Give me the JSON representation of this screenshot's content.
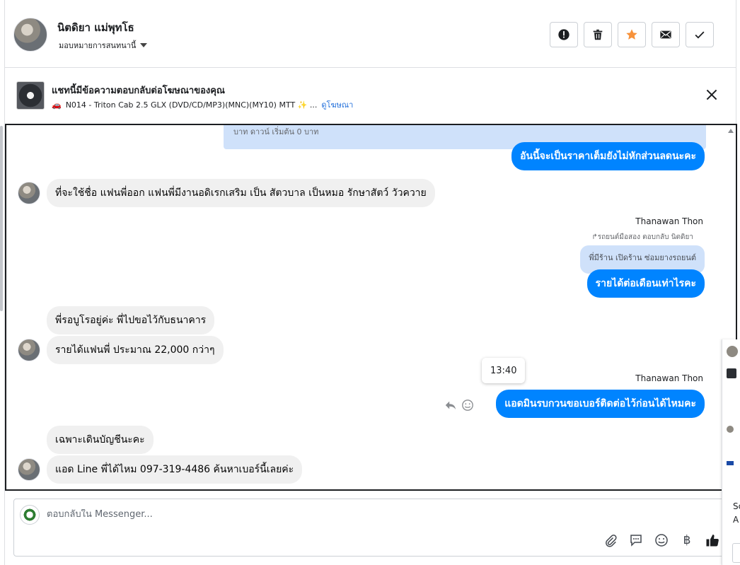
{
  "header": {
    "contact_name": "นิตดิยา แม่พุทโธ",
    "assign_label": "มอบหมายการสนทนานี้",
    "actions": [
      {
        "name": "report",
        "icon": "alert-icon"
      },
      {
        "name": "delete",
        "icon": "trash-icon"
      },
      {
        "name": "star",
        "icon": "star-icon",
        "color": "#f7923b"
      },
      {
        "name": "mark-unread",
        "icon": "envelope-icon"
      },
      {
        "name": "mark-done",
        "icon": "check-icon"
      }
    ]
  },
  "ad_banner": {
    "title": "แชทนี้มีข้อความตอบกลับต่อโฆษณาของคุณ",
    "subtitle": "N014 - Triton Cab 2.5 GLX (DVD/CD/MP3)(MNC)(MY10) MTT ✨ ...",
    "link_label": "ดูโฆษณา"
  },
  "messages": {
    "quoted_top": "บาท ดาวน์ เริ่มต้น 0 บาท",
    "m1": "อันนี้จะเป็นราคาเต็มยังไม่หักส่วนลดนะคะ",
    "m2": "ที่จะใช้ชื่อ แฟนพี่ออก แฟนพี่มีงานอดิเรกเสริม เป็น สัตวบาล เป็นหมอ รักษาสัตว์ วัวควาย",
    "sender_1": "Thanawan Thon",
    "reply_meta": "รถยนต์มือสอง ตอบกลับ นิตดิยา",
    "quote_text": "พี่มีร้าน เปิดร้าน ซ่อมยางรถยนต์",
    "m3": "รายได้ต่อเดือนเท่าไรคะ",
    "m4": "พี่รอบูโรอยู่ค่ะ พี่ไปขอไว้กับธนาคาร",
    "m5": "รายได้แฟนพี่ ประมาณ 22,000 กว่าๆ",
    "time_tooltip": "13:40",
    "sender_2": "Thanawan Thon",
    "m6": "แอดมินรบกวนขอเบอร์ติดต่อไว้ก่อนได้ไหมคะ",
    "m7": "เฉพาะเดินบัญชีนะคะ",
    "m8": "แอด Line พี่ได้ไหม 097-319-4486 ค้นหาเบอร์นี้เลยค่ะ"
  },
  "composer": {
    "placeholder": "ตอบกลับใน Messenger...",
    "tools": [
      "paperclip-icon",
      "saved-reply-icon",
      "emoji-icon",
      "baht-icon",
      "thumbs-up-icon"
    ],
    "baht_symbol": "฿"
  },
  "side_panel": {
    "text_1": "Sc",
    "text_2": "A"
  },
  "colors": {
    "outgoing_bubble": "#0084ff",
    "incoming_bubble": "#f0f0f0",
    "quote_bg": "#cfe1fa",
    "link": "#216fdb"
  }
}
